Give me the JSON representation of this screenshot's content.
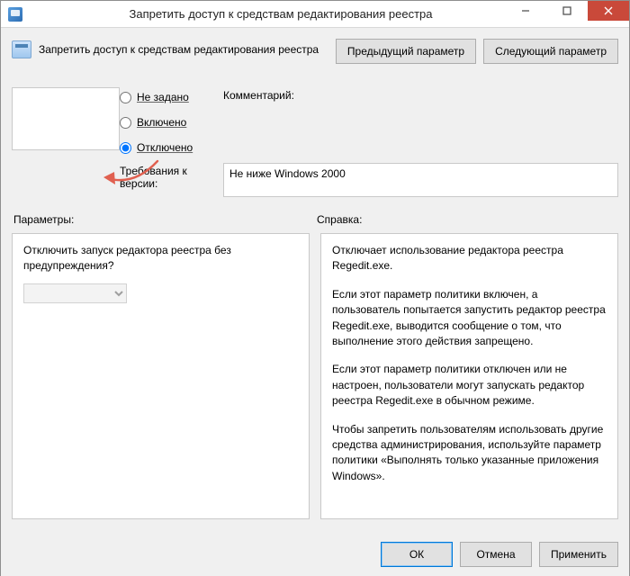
{
  "window": {
    "title": "Запретить доступ к средствам редактирования реестра"
  },
  "header": {
    "subtitle": "Запретить доступ к средствам редактирования реестра",
    "prev": "Предыдущий параметр",
    "next": "Следующий параметр"
  },
  "state": {
    "options": {
      "not_configured": "Не задано",
      "enabled": "Включено",
      "disabled": "Отключено"
    },
    "selected": "disabled",
    "comment_label": "Комментарий:",
    "comment_value": "",
    "req_label": "Требования к версии:",
    "req_value": "Не ниже Windows 2000"
  },
  "panes": {
    "params_label": "Параметры:",
    "help_label": "Справка:",
    "params_text": "Отключить запуск редактора реестра без предупреждения?",
    "params_select_value": "",
    "help_paragraphs": [
      "Отключает использование редактора реестра Regedit.exe.",
      "Если этот параметр политики включен, а пользователь попытается запустить редактор реестра Regedit.exe, выводится сообщение о том, что выполнение этого действия запрещено.",
      "Если этот параметр политики отключен или не настроен, пользователи могут запускать редактор реестра Regedit.exe в обычном режиме.",
      "Чтобы запретить пользователям использовать другие средства администрирования, используйте параметр политики «Выполнять только указанные приложения Windows»."
    ]
  },
  "footer": {
    "ok": "ОК",
    "cancel": "Отмена",
    "apply": "Применить"
  }
}
